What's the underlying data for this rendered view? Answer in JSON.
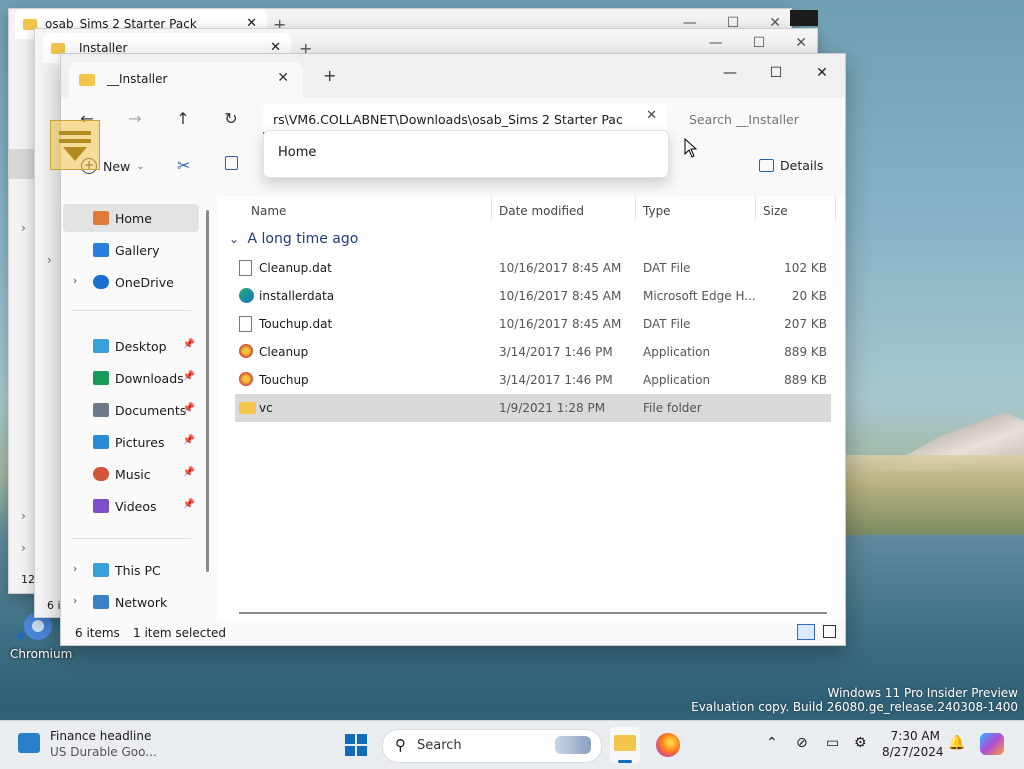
{
  "desktop": {
    "chromium_label": "Chromium",
    "watermark_line1": "Windows 11 Pro Insider Preview",
    "watermark_line2": "Evaluation copy. Build 26080.ge_release.240308-1400",
    "peek1": "12",
    "peek2": "6 i"
  },
  "bg_window_1": {
    "tab_title": "osab_Sims 2 Starter Pack"
  },
  "bg_window_2": {
    "tab_title": "_Installer"
  },
  "window": {
    "tab_title": "__Installer",
    "close_tab": "✕",
    "new_tab": "+",
    "minimize": "—",
    "maximize": "☐",
    "close": "✕"
  },
  "nav": {
    "back": "←",
    "forward": "→",
    "up": "↑",
    "refresh": "↻",
    "address_value": "rs\\VM6.COLLABNET\\Downloads\\osab_Sims 2 Starter Pack",
    "address_clear": "✕",
    "search_placeholder": "Search __Installer",
    "suggestion": "Home"
  },
  "commands": {
    "new_label": "New",
    "new_chevron": "⌄",
    "details_label": "Details"
  },
  "navpane": {
    "items": [
      {
        "label": "Home",
        "icon": "home-icon",
        "color": "#e07a3b"
      },
      {
        "label": "Gallery",
        "icon": "gallery-icon",
        "color": "#2b7de0"
      },
      {
        "label": "OneDrive",
        "icon": "cloud-icon",
        "color": "#1b6fd1"
      },
      {
        "label": "Desktop",
        "icon": "desktop-icon",
        "color": "#3aa0d8"
      },
      {
        "label": "Downloads",
        "icon": "download-icon",
        "color": "#1a9a5a"
      },
      {
        "label": "Documents",
        "icon": "document-icon",
        "color": "#6c7b8a"
      },
      {
        "label": "Pictures",
        "icon": "pictures-icon",
        "color": "#2a8ad6"
      },
      {
        "label": "Music",
        "icon": "music-icon",
        "color": "#d2563b"
      },
      {
        "label": "Videos",
        "icon": "video-icon",
        "color": "#7b4fc9"
      },
      {
        "label": "This PC",
        "icon": "computer-icon",
        "color": "#3aa0d8"
      },
      {
        "label": "Network",
        "icon": "network-icon",
        "color": "#3b82c4"
      }
    ]
  },
  "list": {
    "columns": {
      "name": "Name",
      "date": "Date modified",
      "type": "Type",
      "size": "Size"
    },
    "group_label": "A long time ago",
    "group_chevron": "⌄",
    "rows": [
      {
        "name": "Cleanup.dat",
        "date": "10/16/2017 8:45 AM",
        "type": "DAT File",
        "size": "102 KB",
        "icon": "file-icon"
      },
      {
        "name": "installerdata",
        "date": "10/16/2017 8:45 AM",
        "type": "Microsoft Edge H...",
        "size": "20 KB",
        "icon": "edge-icon"
      },
      {
        "name": "Touchup.dat",
        "date": "10/16/2017 8:45 AM",
        "type": "DAT File",
        "size": "207 KB",
        "icon": "file-icon"
      },
      {
        "name": "Cleanup",
        "date": "3/14/2017 1:46 PM",
        "type": "Application",
        "size": "889 KB",
        "icon": "app-icon"
      },
      {
        "name": "Touchup",
        "date": "3/14/2017 1:46 PM",
        "type": "Application",
        "size": "889 KB",
        "icon": "app-icon"
      },
      {
        "name": "vc",
        "date": "1/9/2021 1:28 PM",
        "type": "File folder",
        "size": "",
        "icon": "folder-icon"
      }
    ]
  },
  "status": {
    "count": "6 items",
    "selected": "1 item selected"
  },
  "taskbar": {
    "widget_title": "Finance headline",
    "widget_sub": "US Durable Goo...",
    "search_label": "Search",
    "time": "7:30 AM",
    "date": "8/27/2024",
    "chevron_up": "⌃"
  }
}
